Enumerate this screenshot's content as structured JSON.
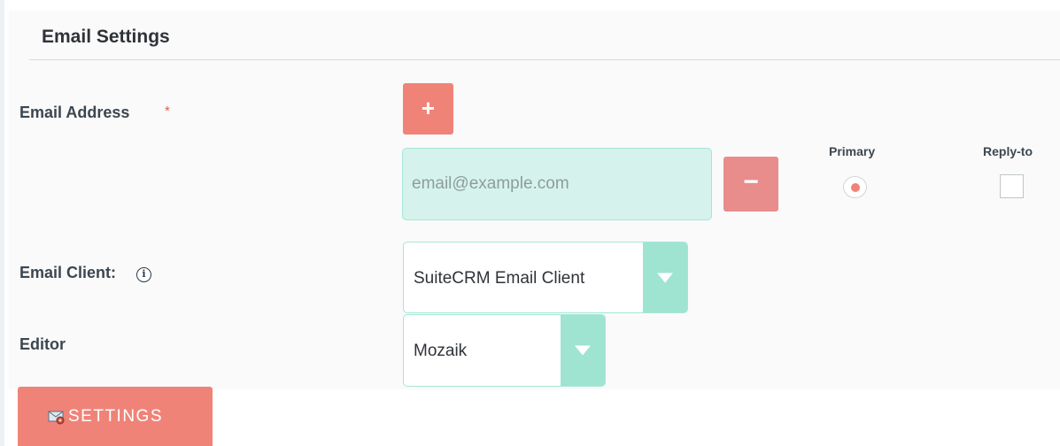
{
  "section": {
    "title": "Email Settings"
  },
  "email_address": {
    "label": "Email Address",
    "required_marker": "*",
    "input_placeholder": "email@example.com",
    "input_value": "",
    "add_button_glyph": "+",
    "remove_button_glyph": "−",
    "primary_header": "Primary",
    "reply_to_header": "Reply-to",
    "primary_selected": true,
    "reply_to_checked": false
  },
  "email_client": {
    "label": "Email Client:",
    "info_icon": "info-icon",
    "selected": "SuiteCRM Email Client"
  },
  "editor": {
    "label": "Editor",
    "selected": "Mozaik"
  },
  "settings_button": {
    "label": "SETTINGS",
    "icon": "settings-gear-icon"
  },
  "colors": {
    "accent": "#f08377",
    "input_bg": "#d5f3ec",
    "select_arrow": "#9fe3d1"
  }
}
